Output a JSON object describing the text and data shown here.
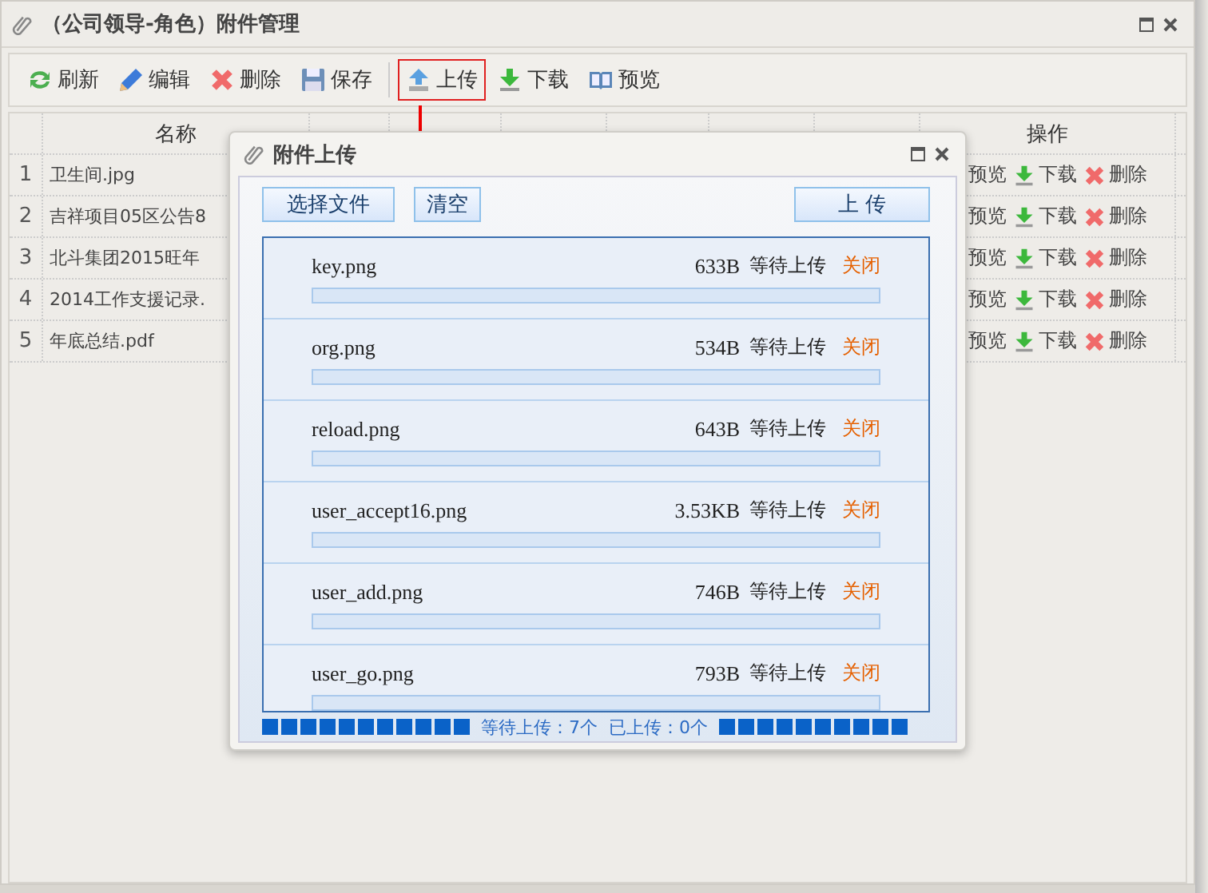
{
  "window": {
    "title": "（公司领导-角色）附件管理"
  },
  "toolbar": [
    {
      "kind": "refresh",
      "label": "刷新",
      "annotated": false
    },
    {
      "kind": "edit",
      "label": "编辑",
      "annotated": false
    },
    {
      "kind": "delete",
      "label": "删除",
      "annotated": false
    },
    {
      "kind": "save",
      "label": "保存",
      "annotated": false
    },
    {
      "kind": "separator"
    },
    {
      "kind": "upload",
      "label": "上传",
      "annotated": true
    },
    {
      "kind": "download",
      "label": "下载",
      "annotated": false
    },
    {
      "kind": "preview",
      "label": "预览",
      "annotated": false
    }
  ],
  "table": {
    "columns": [
      "名称",
      "操作"
    ],
    "rows": [
      {
        "index": "1",
        "name": "卫生间.jpg",
        "actions": [
          {
            "kind": "preview",
            "label": "预览"
          },
          {
            "kind": "download",
            "label": "下载"
          },
          {
            "kind": "delete",
            "label": "删除"
          }
        ]
      },
      {
        "index": "2",
        "name": "吉祥项目05区公告8",
        "actions": [
          {
            "kind": "preview",
            "label": "预览"
          },
          {
            "kind": "download",
            "label": "下载"
          },
          {
            "kind": "delete",
            "label": "删除"
          }
        ]
      },
      {
        "index": "3",
        "name": "北斗集团2015旺年",
        "actions": [
          {
            "kind": "preview",
            "label": "预览"
          },
          {
            "kind": "download",
            "label": "下载"
          },
          {
            "kind": "delete",
            "label": "删除"
          }
        ]
      },
      {
        "index": "4",
        "name": "2014工作支援记录.",
        "actions": [
          {
            "kind": "preview",
            "label": "预览"
          },
          {
            "kind": "download",
            "label": "下载"
          },
          {
            "kind": "delete",
            "label": "删除"
          }
        ]
      },
      {
        "index": "5",
        "name": "年底总结.pdf",
        "actions": [
          {
            "kind": "preview",
            "label": "预览"
          },
          {
            "kind": "download",
            "label": "下载"
          },
          {
            "kind": "delete",
            "label": "删除"
          }
        ]
      }
    ]
  },
  "dialog": {
    "title": "附件上传",
    "select_button": "选择文件",
    "clear_button": "清空",
    "upload_button": "上 传",
    "files": [
      {
        "name": "key.png",
        "size": "633B",
        "status": "等待上传",
        "action": "关闭",
        "level": 0
      },
      {
        "name": "org.png",
        "size": "534B",
        "status": "等待上传",
        "action": "关闭",
        "level": 0
      },
      {
        "name": "reload.png",
        "size": "643B",
        "status": "等待上传",
        "action": "关闭",
        "level": 0
      },
      {
        "name": "user_accept16.png",
        "size": "3.53KB",
        "status": "等待上传",
        "action": "关闭",
        "level": 0
      },
      {
        "name": "user_add.png",
        "size": "746B",
        "status": "等待上传",
        "action": "关闭",
        "level": 0
      },
      {
        "name": "user_go.png",
        "size": "793B",
        "status": "等待上传",
        "action": "关闭",
        "level": 0
      }
    ],
    "footer": {
      "waiting": "等待上传：7个",
      "uploaded": "已上传：0个"
    }
  }
}
